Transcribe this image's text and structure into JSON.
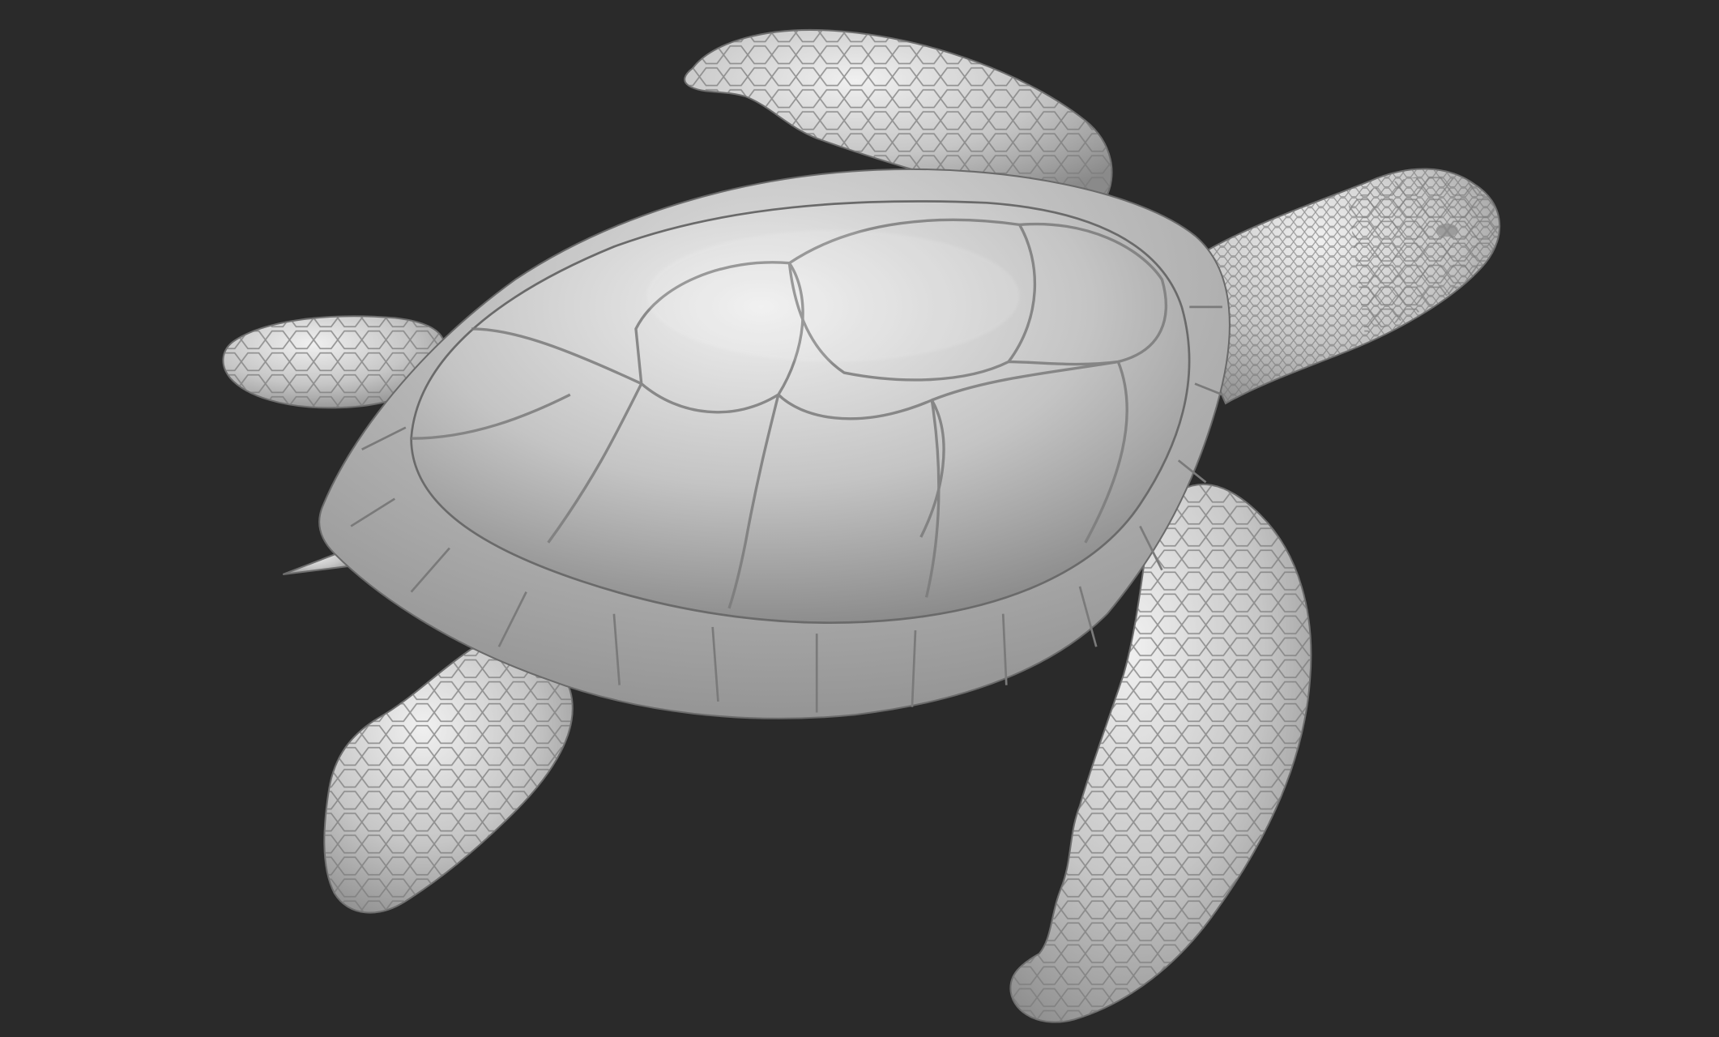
{
  "scene": {
    "background_color": "#2a2a2a",
    "model_color": "#c9c9c9",
    "subject": "turtle-sculpt"
  }
}
